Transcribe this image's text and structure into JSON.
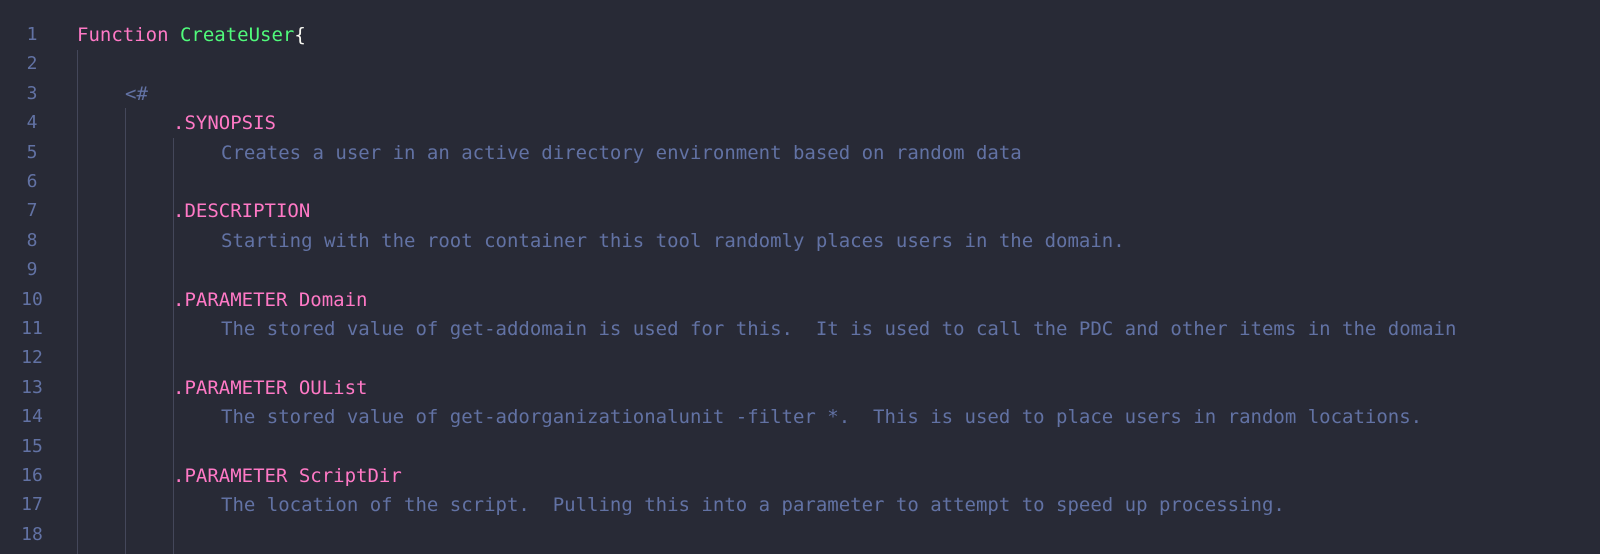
{
  "editor": {
    "lines": [
      {
        "num": "1",
        "parts": [
          {
            "t": "Function",
            "c": "kw"
          },
          {
            "t": " "
          },
          {
            "t": "CreateUser",
            "c": "fn"
          },
          {
            "t": "{",
            "c": "brace"
          }
        ],
        "indent": 0
      },
      {
        "num": "2",
        "parts": [],
        "indent": 0
      },
      {
        "num": "3",
        "parts": [
          {
            "t": "<#",
            "c": "comment"
          }
        ],
        "indent": 1
      },
      {
        "num": "4",
        "parts": [
          {
            "t": ".SYNOPSIS",
            "c": "doc-kw"
          }
        ],
        "indent": 2
      },
      {
        "num": "5",
        "parts": [
          {
            "t": "Creates a user in an active directory environment based on random data",
            "c": "comment"
          }
        ],
        "indent": 3
      },
      {
        "num": "6",
        "parts": [],
        "indent": 0
      },
      {
        "num": "7",
        "parts": [
          {
            "t": ".DESCRIPTION",
            "c": "doc-kw"
          }
        ],
        "indent": 2
      },
      {
        "num": "8",
        "parts": [
          {
            "t": "Starting with the root container this tool randomly places users in the domain.",
            "c": "comment"
          }
        ],
        "indent": 3
      },
      {
        "num": "9",
        "parts": [],
        "indent": 0
      },
      {
        "num": "10",
        "parts": [
          {
            "t": ".PARAMETER Domain",
            "c": "doc-kw"
          }
        ],
        "indent": 2
      },
      {
        "num": "11",
        "parts": [
          {
            "t": "The stored value of get-addomain is used for this.  It is used to call the PDC and other items in the domain",
            "c": "comment"
          }
        ],
        "indent": 3
      },
      {
        "num": "12",
        "parts": [],
        "indent": 0
      },
      {
        "num": "13",
        "parts": [
          {
            "t": ".PARAMETER OUList",
            "c": "doc-kw"
          }
        ],
        "indent": 2
      },
      {
        "num": "14",
        "parts": [
          {
            "t": "The stored value of get-adorganizationalunit -filter *.  This is used to place users in random locations.",
            "c": "comment"
          }
        ],
        "indent": 3
      },
      {
        "num": "15",
        "parts": [],
        "indent": 0
      },
      {
        "num": "16",
        "parts": [
          {
            "t": ".PARAMETER ScriptDir",
            "c": "doc-kw"
          }
        ],
        "indent": 2
      },
      {
        "num": "17",
        "parts": [
          {
            "t": "The location of the script.  Pulling this into a parameter to attempt to speed up processing.",
            "c": "comment"
          }
        ],
        "indent": 3
      },
      {
        "num": "18",
        "parts": [],
        "indent": 0
      }
    ]
  },
  "colors": {
    "background": "#282a36",
    "line_number": "#6272a4",
    "keyword": "#ff79c6",
    "function_name": "#50fa7b",
    "brace": "#f8f8f2",
    "comment": "#6272a4",
    "indent_guide": "#44475a"
  }
}
